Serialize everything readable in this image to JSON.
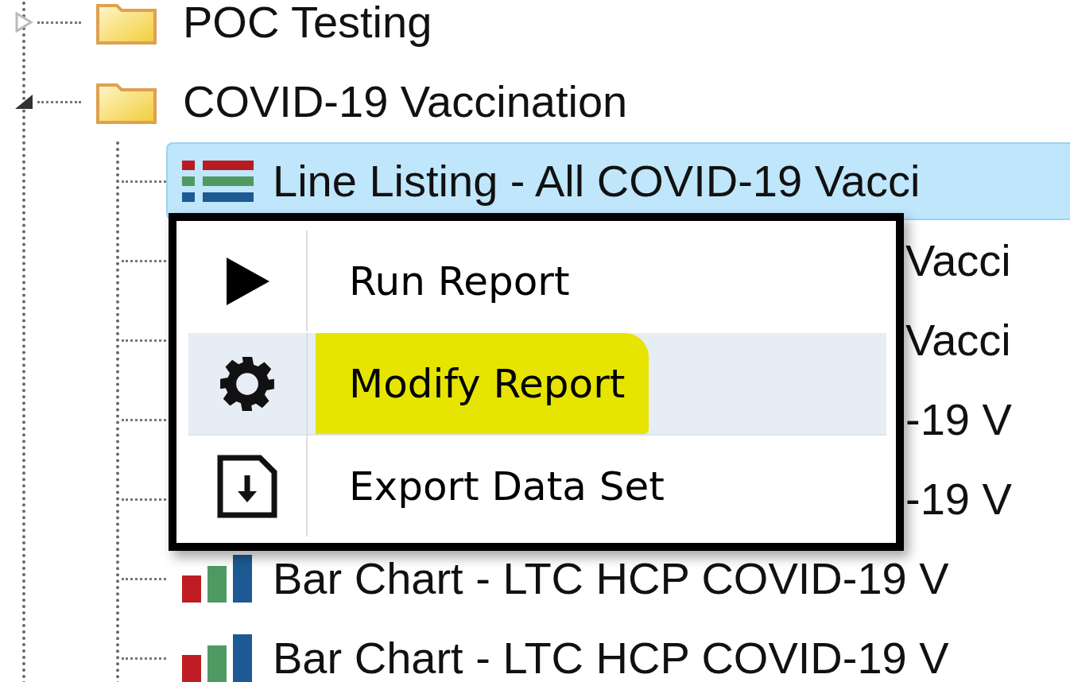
{
  "tree": [
    {
      "label": "POC Testing",
      "expanded": false
    },
    {
      "label": "COVID-19 Vaccination",
      "expanded": true,
      "children": [
        {
          "kind": "line_listing",
          "label": "Line Listing - All COVID-19 Vacci",
          "selected": true
        },
        {
          "kind": "fragment",
          "label": "Vacci",
          "selected": false
        },
        {
          "kind": "fragment",
          "label": "Vacci",
          "selected": false
        },
        {
          "kind": "fragment",
          "label": "-19 V",
          "selected": false
        },
        {
          "kind": "fragment",
          "label": "-19 V",
          "selected": false
        },
        {
          "kind": "bar_chart",
          "label": "Bar Chart - LTC HCP COVID-19 V",
          "selected": false
        },
        {
          "kind": "bar_chart",
          "label": "Bar Chart - LTC HCP COVID-19 V",
          "selected": false
        }
      ]
    }
  ],
  "context_menu": {
    "items": [
      {
        "kind": "run",
        "label": "Run Report",
        "selected": false,
        "highlighted": false
      },
      {
        "kind": "modify",
        "label": "Modify Report",
        "selected": true,
        "highlighted": true
      },
      {
        "kind": "export",
        "label": "Export Data Set",
        "selected": false,
        "highlighted": false
      }
    ]
  }
}
